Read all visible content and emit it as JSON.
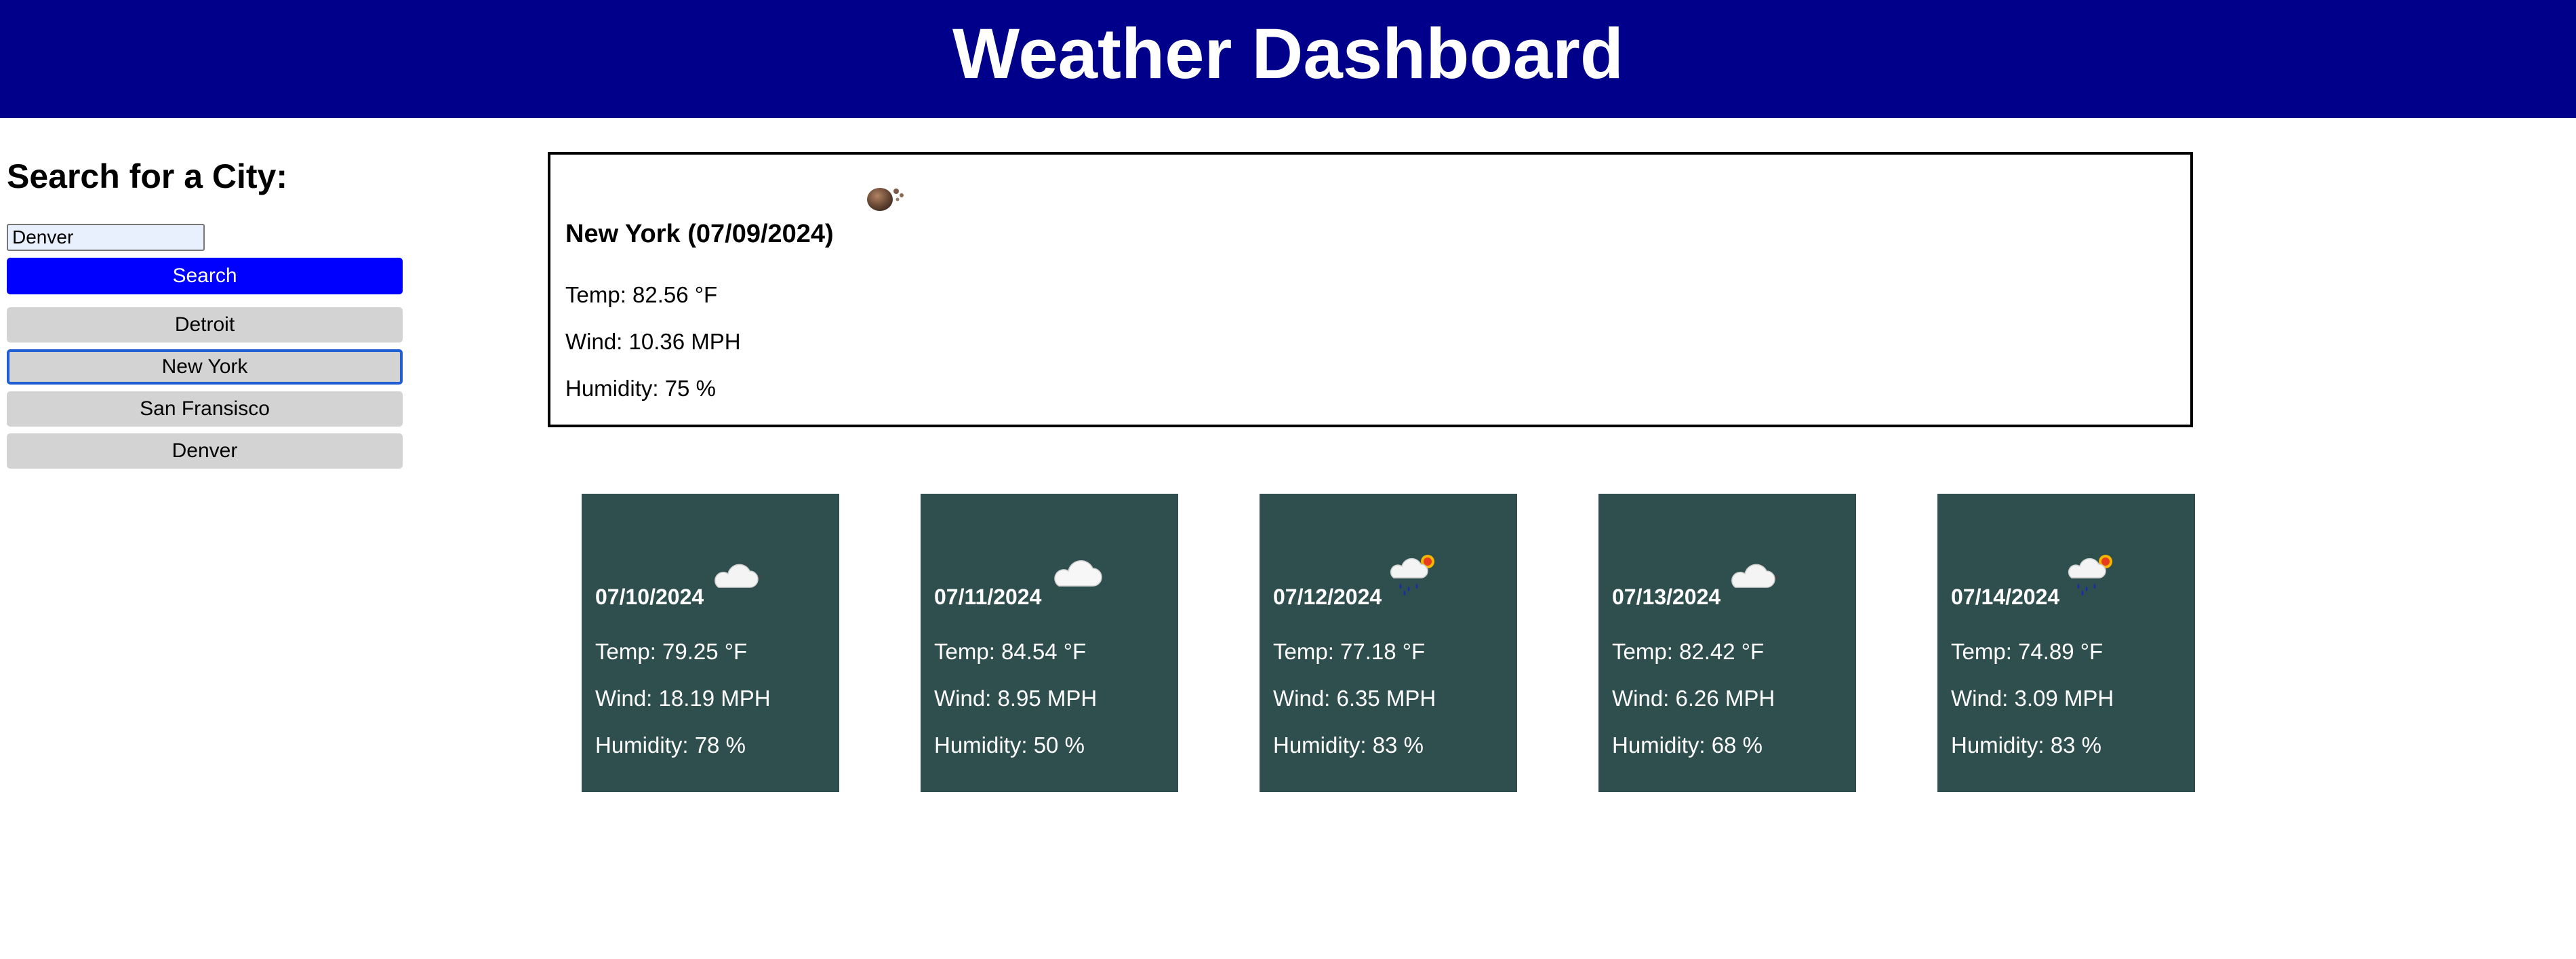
{
  "header": {
    "title": "Weather Dashboard"
  },
  "sidebar": {
    "heading": "Search for a City:",
    "search_value": "Denver",
    "search_button": "Search",
    "history": [
      "Detroit",
      "New York",
      "San Fransisco",
      "Denver"
    ],
    "focused_history_item": "New York"
  },
  "current": {
    "title": "New York (07/09/2024)",
    "icon": "haze-icon",
    "temp": "Temp: 82.56 °F",
    "wind": "Wind: 10.36 MPH",
    "humidity": "Humidity: 75 %"
  },
  "forecast": [
    {
      "date": "07/10/2024",
      "icon": "cloudy-night-icon",
      "temp": "Temp: 79.25 °F",
      "wind": "Wind: 18.19 MPH",
      "humidity": "Humidity: 78 %"
    },
    {
      "date": "07/11/2024",
      "icon": "cloud-icon",
      "temp": "Temp: 84.54 °F",
      "wind": "Wind: 8.95 MPH",
      "humidity": "Humidity: 50 %"
    },
    {
      "date": "07/12/2024",
      "icon": "rain-sun-icon",
      "temp": "Temp: 77.18 °F",
      "wind": "Wind: 6.35 MPH",
      "humidity": "Humidity: 83 %"
    },
    {
      "date": "07/13/2024",
      "icon": "cloudy-night-icon",
      "temp": "Temp: 82.42 °F",
      "wind": "Wind: 6.26 MPH",
      "humidity": "Humidity: 68 %"
    },
    {
      "date": "07/14/2024",
      "icon": "rain-sun-icon",
      "temp": "Temp: 74.89 °F",
      "wind": "Wind: 3.09 MPH",
      "humidity": "Humidity: 83 %"
    }
  ],
  "colors": {
    "header_bg": "#00008b",
    "search_button_bg": "#0000ff",
    "history_button_bg": "#d3d3d3",
    "forecast_card_bg": "#2f4f4f",
    "focus_outline": "#1f5fd1"
  }
}
